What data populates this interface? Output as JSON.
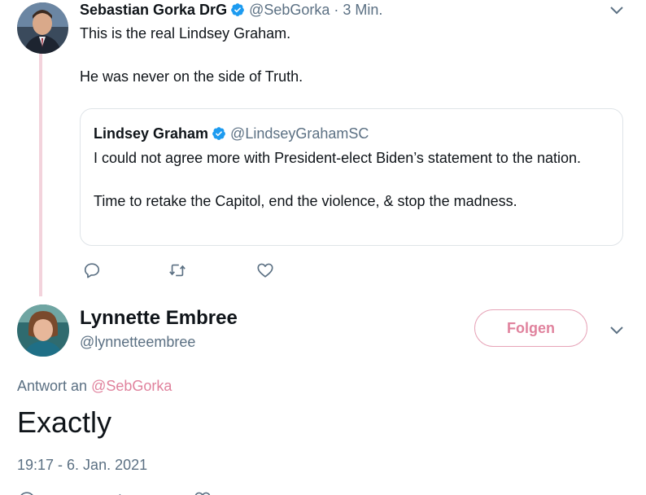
{
  "tweet1": {
    "author_name": "Sebastian Gorka DrG",
    "handle": "@SebGorka",
    "separator": "·",
    "time": "3 Min.",
    "lines": [
      "This is the real Lindsey Graham.",
      "He was never on the side of Truth."
    ],
    "verified_color": "#1d9bf0"
  },
  "quoted": {
    "author_name": "Lindsey Graham",
    "handle": "@LindseyGrahamSC",
    "lines": [
      "I could not agree more with President-elect Biden’s statement to the nation.",
      "Time to retake the Capitol, end the violence, & stop the madness."
    ]
  },
  "actions": {
    "reply_icon": "reply-icon",
    "retweet_icon": "retweet-icon",
    "like_icon": "heart-icon"
  },
  "tweet2": {
    "author_name": "Lynnette Embree",
    "handle": "@lynnetteembree",
    "follow_label": "Folgen",
    "reply_prefix": "Antwort an",
    "reply_mention": "@SebGorka",
    "text": "Exactly",
    "timestamp": "19:17 - 6. Jan. 2021"
  },
  "colors": {
    "accent": "#e0829d",
    "thread_line": "#f3d3dc",
    "muted_text": "#5b7083",
    "border": "#dfe4e8"
  }
}
